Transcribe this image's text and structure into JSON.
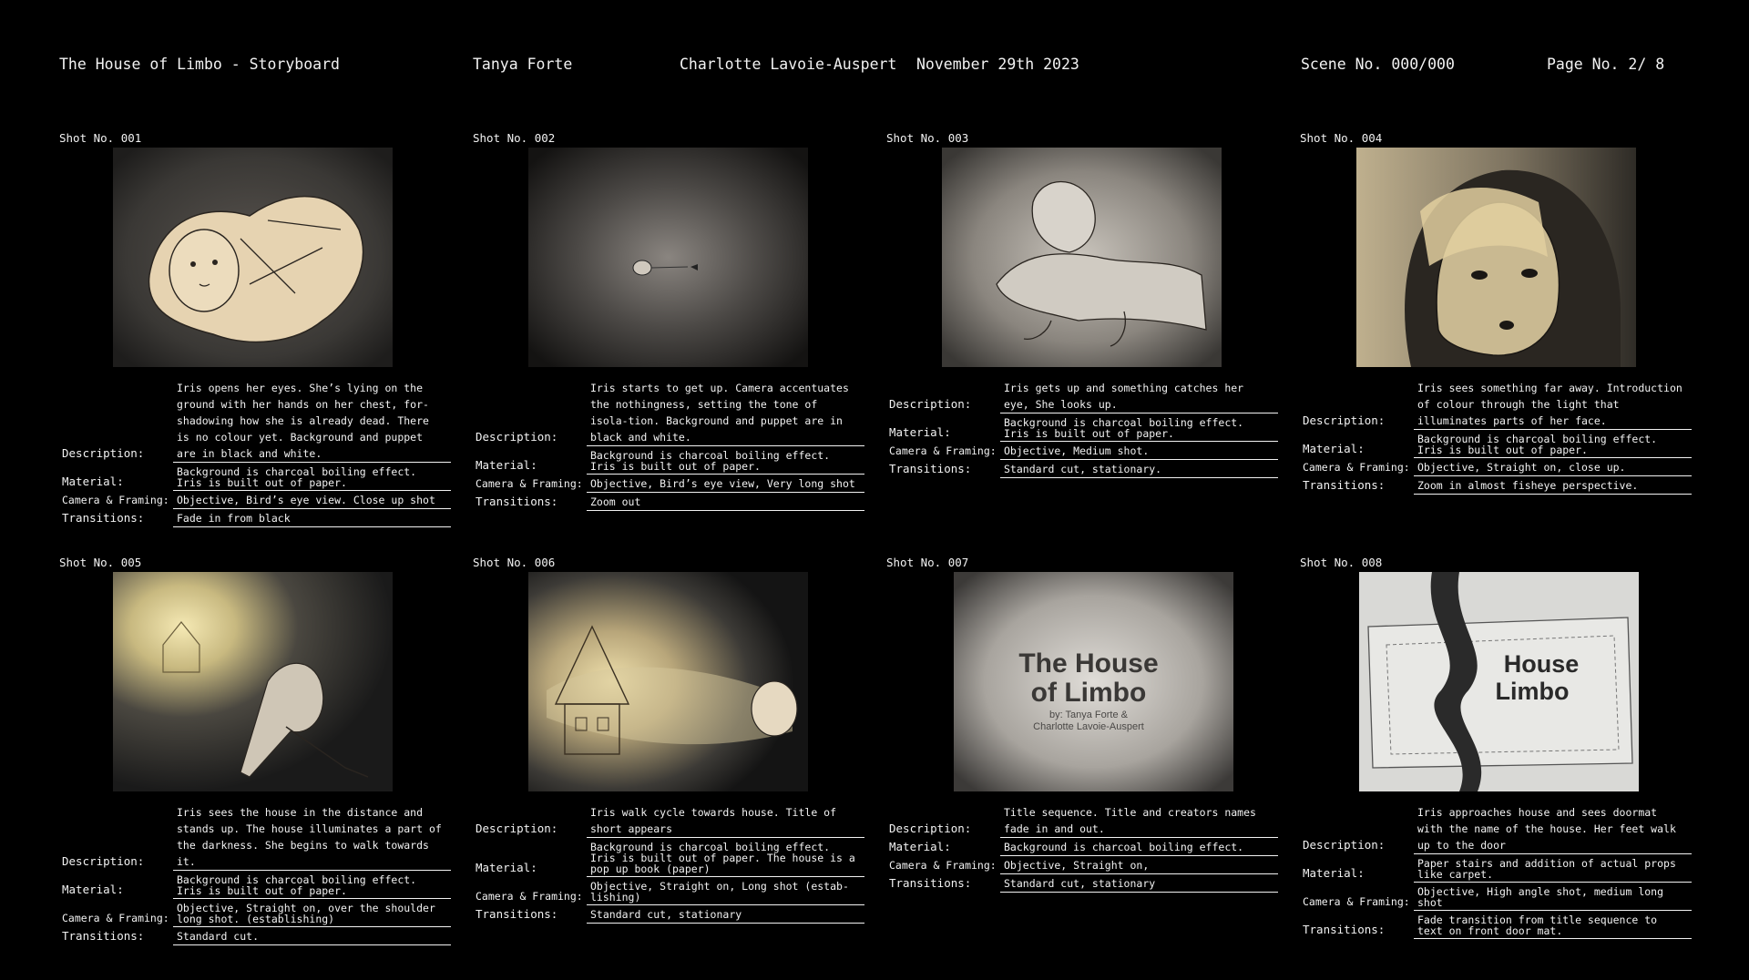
{
  "header": {
    "title": "The House of Limbo - Storyboard",
    "author1": "Tanya Forte",
    "author2": "Charlotte Lavoie-Auspert",
    "date": "November 29th 2023",
    "scene": "Scene No. 000/000",
    "page": "Page No. 2/ 8"
  },
  "labels": {
    "description": "Description:",
    "material": "Material:",
    "camera": "Camera & Framing:",
    "transitions": "Transitions:"
  },
  "colors": {
    "background": "#000000",
    "text": "#f2f2f2",
    "paper": "#e6d3b1"
  },
  "shots": [
    {
      "label": "Shot No. 001",
      "image": "iris-lying-hands-on-chest-sketch",
      "description": "Iris opens her eyes. She’s lying on the ground with her hands on her chest, for-shadowing how she is already dead. There is no colour yet. Background and puppet are in black and white.",
      "material": "Background is charcoal boiling effect. Iris is built out of paper.",
      "camera": "Objective, Bird’s eye view. Close up shot",
      "transitions": "Fade in from black"
    },
    {
      "label": "Shot No. 002",
      "image": "tiny-iris-in-charcoal-void",
      "description": "Iris starts to get up. Camera accentuates the nothingness, setting the tone of isola-tion. Background and puppet are in black and white.",
      "material": "Background is charcoal boiling effect. Iris is built out of paper.",
      "camera": "Objective, Bird’s eye view, Very long shot",
      "transitions": "Zoom out"
    },
    {
      "label": "Shot No. 003",
      "image": "iris-getting-up-looking-up",
      "description": "Iris gets up and something catches her eye, She looks up.",
      "material": "Background is charcoal boiling effect. Iris is built out of paper.",
      "camera": "Objective, Medium shot.",
      "transitions": "Standard cut, stationary."
    },
    {
      "label": "Shot No. 004",
      "image": "iris-face-close-up-light",
      "description": "Iris sees something far away. Introduction of colour through the light that illuminates parts of her face.",
      "material": "Background is charcoal boiling effect. Iris is built out of paper.",
      "camera": "Objective, Straight on, close up.",
      "transitions": "Zoom in almost fisheye perspective."
    },
    {
      "label": "Shot No. 005",
      "image": "iris-sees-house-in-distance",
      "description": "Iris sees the house in the distance and stands up. The house illuminates a part of the darkness. She begins to walk towards it.",
      "material": "Background is charcoal boiling effect. Iris is built out of paper.",
      "camera": "Objective, Straight on, over the shoulder long shot. (establishing)",
      "transitions": "Standard cut."
    },
    {
      "label": "Shot No. 006",
      "image": "iris-walking-towards-house",
      "description": "Iris walk cycle towards house. Title of short appears",
      "material": "Background is charcoal boiling effect. Iris is built out of paper. The house is a pop up book (paper)",
      "camera": "Objective, Straight on, Long shot (estab-lishing)",
      "transitions": "Standard cut, stationary"
    },
    {
      "label": "Shot No. 007",
      "image": "title-card",
      "title_line1": "The House",
      "title_line2": "of Limbo",
      "credit_line1": "by: Tanya Forte &",
      "credit_line2": "Charlotte Lavoie-Auspert",
      "description": "Title sequence. Title and creators names fade in and out.",
      "material": "Background is charcoal boiling effect.",
      "camera": "Objective, Straight on,",
      "transitions": "Standard cut, stationary"
    },
    {
      "label": "Shot No. 008",
      "image": "doormat-with-house-name",
      "mat_line1": "House",
      "mat_line2": "Limbo",
      "description": "Iris approaches house and sees doormat with the name of the house. Her feet walk up to the door",
      "material": "Paper stairs and addition of actual props like carpet.",
      "camera": "Objective, High angle shot, medium long shot",
      "transitions": "Fade transition from title sequence to text on front door mat."
    }
  ]
}
